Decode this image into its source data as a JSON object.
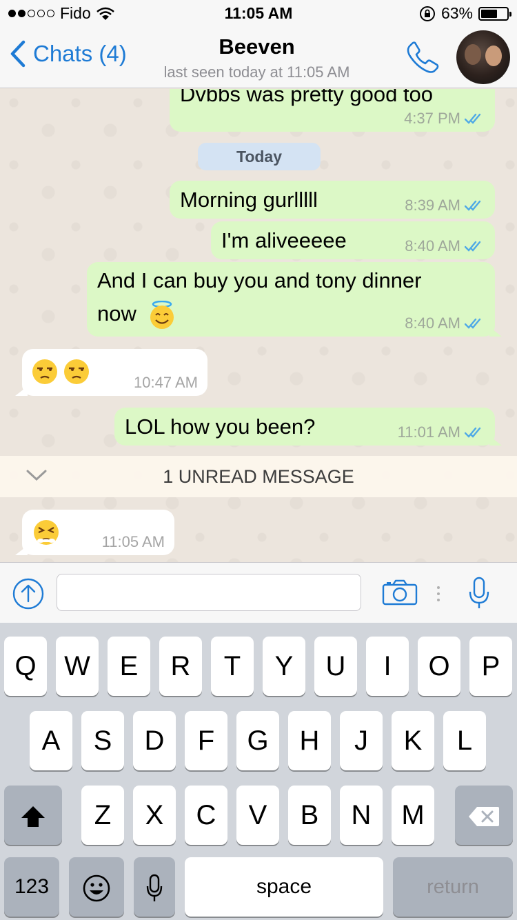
{
  "status_bar": {
    "carrier": "Fido",
    "time": "11:05 AM",
    "battery": "63%",
    "battery_level": 0.63,
    "icons": [
      "signal-dots-icon",
      "wifi-icon",
      "rotation-lock-icon",
      "battery-icon"
    ]
  },
  "nav": {
    "back_label": "Chats (4)",
    "contact_name": "Beeven",
    "last_seen": "last seen today at 11:05 AM",
    "icons": [
      "chevron-left-icon",
      "phone-icon",
      "avatar"
    ]
  },
  "chat": {
    "date_divider": "Today",
    "messages": [
      {
        "direction": "outgoing",
        "text": "Dvbbs was pretty good too",
        "time": "4:37 PM",
        "read": true
      },
      {
        "direction": "outgoing",
        "text": "Morning gurlllll",
        "time": "8:39 AM",
        "read": true
      },
      {
        "direction": "outgoing",
        "text": "I'm aliveeeee",
        "time": "8:40 AM",
        "read": true
      },
      {
        "direction": "outgoing",
        "text_line1": "And I can buy you and tony dinner",
        "text_line2": "now",
        "emoji": "smiling-face-with-halo",
        "time": "8:40 AM",
        "read": true
      },
      {
        "direction": "incoming",
        "emoji": [
          "unamused-face",
          "unamused-face"
        ],
        "time": "10:47 AM"
      },
      {
        "direction": "outgoing",
        "text": "LOL how you been?",
        "time": "11:01 AM",
        "read": true
      },
      {
        "direction": "incoming",
        "emoji": [
          "persevering-face"
        ],
        "time": "11:05 AM"
      }
    ],
    "unread_banner": "1 UNREAD MESSAGE"
  },
  "input_bar": {
    "value": "",
    "icons": [
      "share-arrow-icon",
      "camera-icon",
      "microphone-icon"
    ]
  },
  "keyboard": {
    "row1": [
      "Q",
      "W",
      "E",
      "R",
      "T",
      "Y",
      "U",
      "I",
      "O",
      "P"
    ],
    "row2": [
      "A",
      "S",
      "D",
      "F",
      "G",
      "H",
      "J",
      "K",
      "L"
    ],
    "row3": [
      "Z",
      "X",
      "C",
      "V",
      "B",
      "N",
      "M"
    ],
    "numbers_key": "123",
    "space_key": "space",
    "return_key": "return",
    "icons": [
      "shift-icon",
      "delete-icon",
      "emoji-icon",
      "dictation-mic-icon"
    ]
  },
  "colors": {
    "accent_blue": "#1e7bd5",
    "outgoing_bubble": "#dcf8c6",
    "incoming_bubble": "#ffffff",
    "chat_background": "#ece5dd",
    "read_ticks": "#4fa9e6"
  }
}
